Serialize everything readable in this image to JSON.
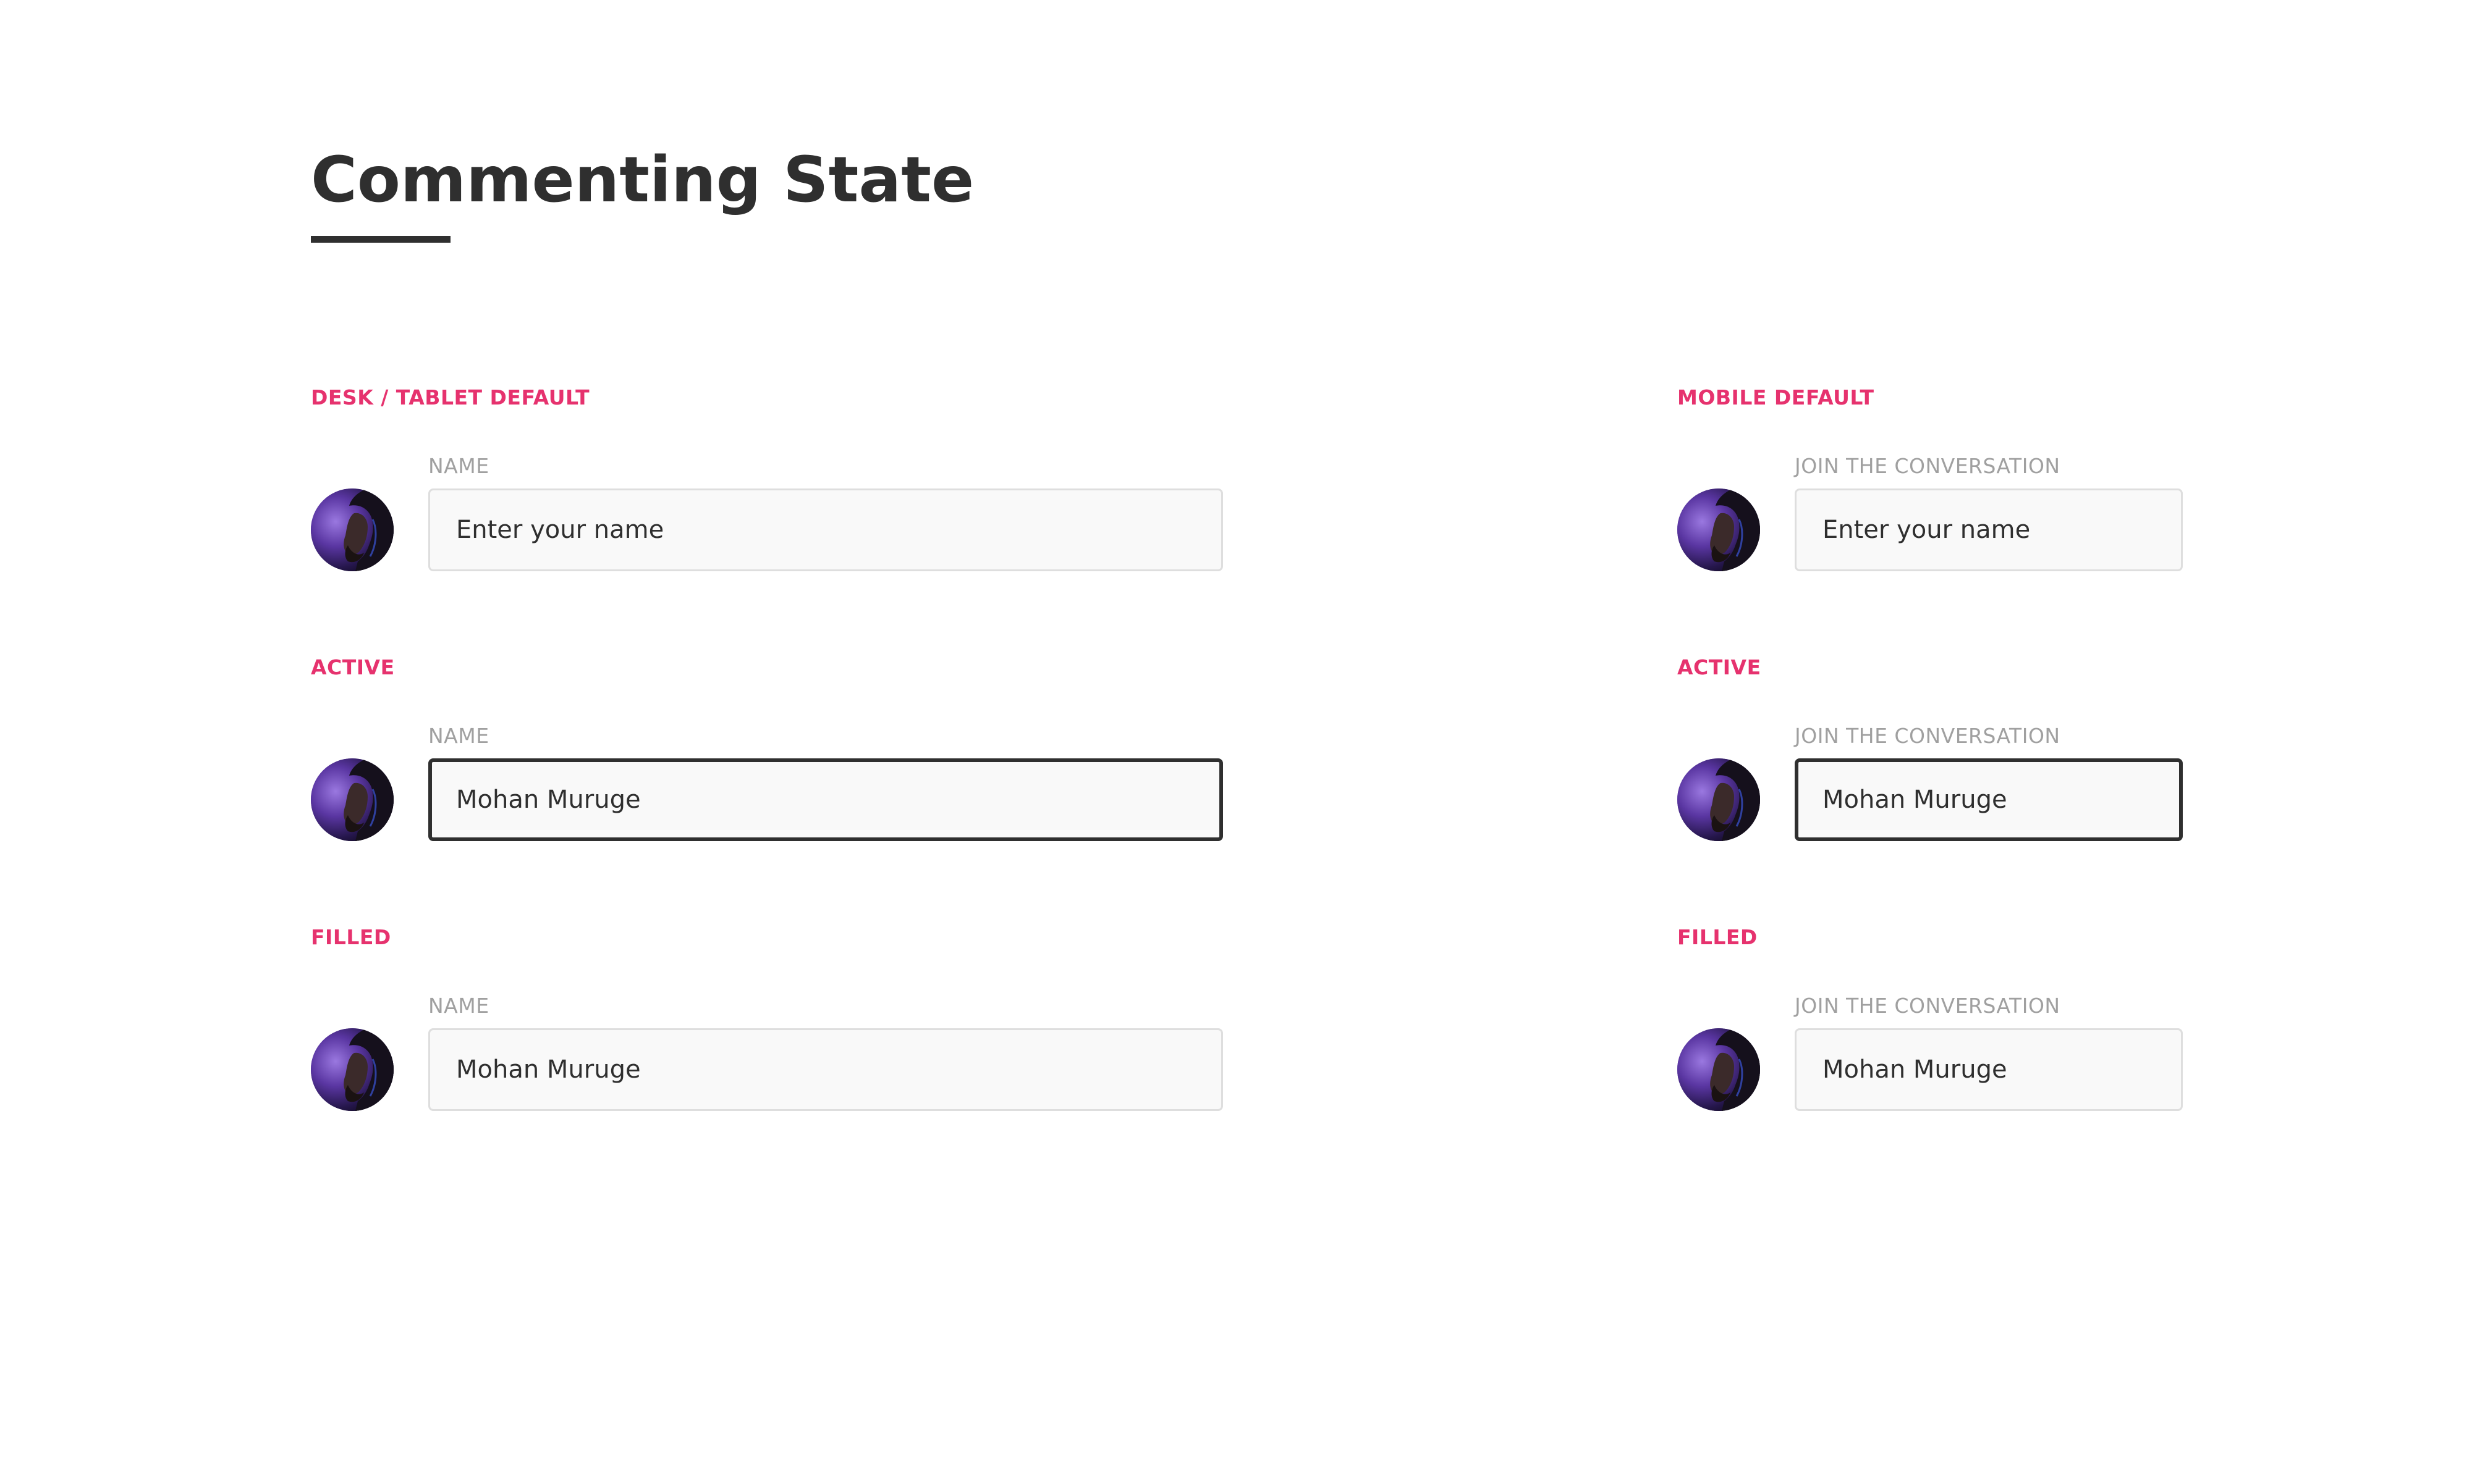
{
  "page": {
    "title": "Commenting State"
  },
  "colors": {
    "accent": "#e6326e",
    "text": "#2f2f2f",
    "label_muted": "#a0a0a0",
    "field_bg": "#f9f9f9",
    "field_border": "#dedede",
    "field_border_active": "#2f2f2f"
  },
  "desk": {
    "default": {
      "section_label": "DESK / TABLET DEFAULT",
      "field_label": "NAME",
      "placeholder": "Enter your name",
      "value": ""
    },
    "active": {
      "section_label": "ACTIVE",
      "field_label": "NAME",
      "value": "Mohan Muruge"
    },
    "filled": {
      "section_label": "FILLED",
      "field_label": "NAME",
      "value": "Mohan Muruge"
    }
  },
  "mobile": {
    "default": {
      "section_label": "MOBILE DEFAULT",
      "field_label": "JOIN THE CONVERSATION",
      "placeholder": "Enter your name",
      "value": ""
    },
    "active": {
      "section_label": "ACTIVE",
      "field_label": "JOIN THE CONVERSATION",
      "value": "Mohan Muruge"
    },
    "filled": {
      "section_label": "FILLED",
      "field_label": "JOIN THE CONVERSATION",
      "value": "Mohan Muruge"
    }
  },
  "avatar": {
    "icon": "user-avatar-photo"
  }
}
